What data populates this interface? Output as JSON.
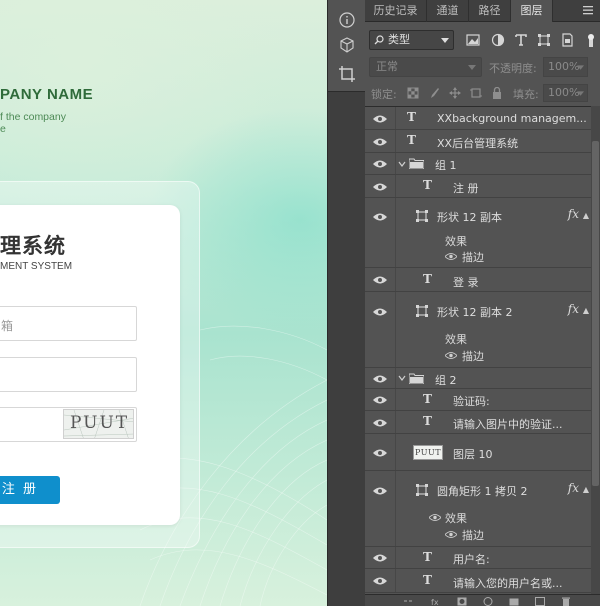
{
  "canvas": {
    "company_name": "PANY NAME",
    "company_sub1": "f the company",
    "company_sub2": "e",
    "title": "理系统",
    "subtitle": "MENT SYSTEM",
    "email_placeholder": "箱",
    "captcha_text": "PUUT",
    "register_label": "注 册"
  },
  "tabs": [
    "历史记录",
    "通道",
    "路径",
    "图层"
  ],
  "active_tab": "图层",
  "filter": {
    "kind_label": "类型",
    "icons": [
      "image-filter-icon",
      "adjustment-filter-icon",
      "type-filter-icon",
      "shape-filter-icon",
      "smart-object-filter-icon",
      "filter-toggle-icon"
    ]
  },
  "blend": {
    "mode": "正常",
    "opacity_label": "不透明度:",
    "opacity_value": "100%"
  },
  "lock": {
    "label": "锁定:",
    "fill_label": "填充:",
    "fill_value": "100%"
  },
  "layers": [
    {
      "name": "XXbackground managem...",
      "kind": "text"
    },
    {
      "name": "XX后台管理系统",
      "kind": "text"
    },
    {
      "name": "组 1",
      "kind": "group"
    },
    {
      "name": "注 册",
      "kind": "text"
    },
    {
      "name": "形状 12 副本",
      "kind": "shape",
      "effect_label": "效果",
      "stroke_label": "描边"
    },
    {
      "name": "登 录",
      "kind": "text"
    },
    {
      "name": "形状 12 副本 2",
      "kind": "shape",
      "effect_label": "效果",
      "stroke_label": "描边"
    },
    {
      "name": "组 2",
      "kind": "group"
    },
    {
      "name": "验证码:",
      "kind": "text"
    },
    {
      "name": "请输入图片中的验证...",
      "kind": "text"
    },
    {
      "name": "图层 10",
      "kind": "image",
      "thumb_text": "PUUT"
    },
    {
      "name": "圆角矩形 1 拷贝 2",
      "kind": "shape",
      "effect_label": "效果",
      "stroke_label": "描边"
    },
    {
      "name": "用户名:",
      "kind": "text"
    },
    {
      "name": "请输入您的用户名或...",
      "kind": "text"
    }
  ],
  "fx_label": "fx",
  "colors": {
    "panel_bg": "#535353",
    "tab_bar_bg": "#3f3f3f",
    "register_button": "#0f8fcc",
    "company_green": "#2f6b3a"
  }
}
